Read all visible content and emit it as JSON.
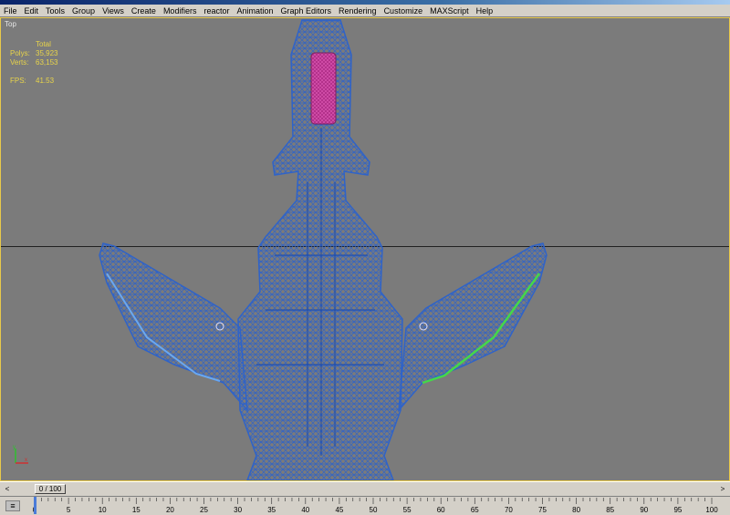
{
  "menu": {
    "items": [
      "File",
      "Edit",
      "Tools",
      "Group",
      "Views",
      "Create",
      "Modifiers",
      "reactor",
      "Animation",
      "Graph Editors",
      "Rendering",
      "Customize",
      "MAXScript",
      "Help"
    ]
  },
  "viewport": {
    "label": "Top",
    "stats": {
      "header": "Total",
      "polys_label": "Polys:",
      "polys_value": "35,923",
      "verts_label": "Verts:",
      "verts_value": "63,153",
      "fps_label": "FPS:",
      "fps_value": "41.53"
    },
    "colors": {
      "background": "#7b7b7b",
      "wire": "#2f63c8",
      "canopy": "#c0328c",
      "green_edge": "#44d84a",
      "light_edge": "#6aa8f0"
    }
  },
  "timeline": {
    "slider_text": "0 / 100",
    "prev_label": "<",
    "next_label": ">",
    "ticks": [
      "0",
      "5",
      "10",
      "15",
      "20",
      "25",
      "30",
      "35",
      "40",
      "45",
      "50",
      "55",
      "60",
      "65",
      "70",
      "75",
      "80",
      "85",
      "90",
      "95",
      "100"
    ]
  }
}
